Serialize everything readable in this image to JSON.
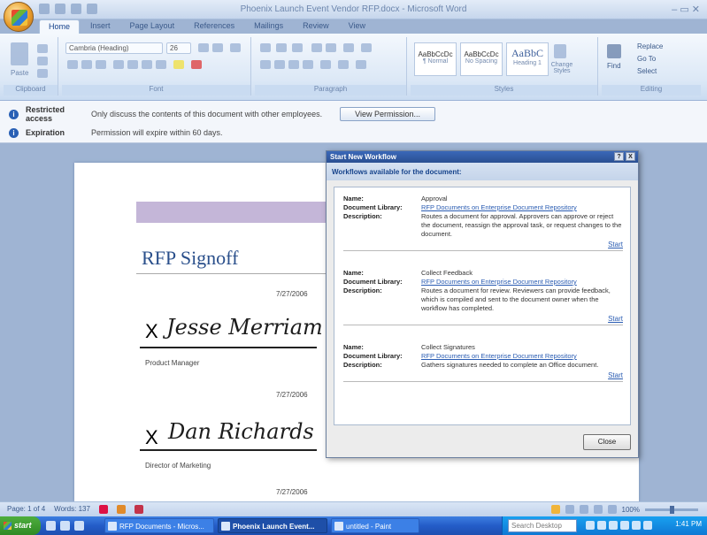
{
  "window": {
    "title": "Phoenix Launch Event Vendor RFP.docx - Microsoft Word",
    "controls": "–  ▭  ✕"
  },
  "ribbon": {
    "tabs": [
      "Home",
      "Insert",
      "Page Layout",
      "References",
      "Mailings",
      "Review",
      "View"
    ],
    "font_name": "Cambria (Heading)",
    "font_size": "26",
    "groups": [
      "Clipboard",
      "Font",
      "Paragraph",
      "Styles",
      "Editing"
    ],
    "paste_label": "Paste",
    "styles": [
      {
        "sample": "AaBbCcDc",
        "name": "¶ Normal"
      },
      {
        "sample": "AaBbCcDc",
        "name": "No Spacing"
      },
      {
        "sample": "AaBbC",
        "name": "Heading 1"
      }
    ],
    "change_styles": "Change Styles",
    "find": "Find",
    "replace": "Replace",
    "goto": "Go To",
    "select": "Select"
  },
  "message_bar": {
    "rows": [
      {
        "label": "Restricted access",
        "text": "Only discuss the contents of this document with other employees.",
        "button": "View Permission..."
      },
      {
        "label": "Expiration",
        "text": "Permission will expire within 60 days."
      }
    ]
  },
  "document": {
    "title": "RFP Signoff",
    "signatures": [
      {
        "date": "7/27/2006",
        "x": "X",
        "name": "Jesse Merriam",
        "role": "Product Manager"
      },
      {
        "date": "7/27/2006",
        "x": "X",
        "name": "Dan Richards",
        "role": "Director of Marketing"
      }
    ],
    "trailing_date": "7/27/2006"
  },
  "dialog": {
    "title": "Start New Workflow",
    "ctrl_help": "?",
    "ctrl_close": "X",
    "header": "Workflows available for the document:",
    "key_name": "Name:",
    "key_library": "Document Library:",
    "key_description": "Description:",
    "workflows": [
      {
        "name": "Approval",
        "library": "RFP Documents on Enterprise Document Repository",
        "description": "Routes a document for approval. Approvers can approve or reject the document, reassign the approval task, or request changes to the document.",
        "start": "Start"
      },
      {
        "name": "Collect Feedback",
        "library": "RFP Documents on Enterprise Document Repository",
        "description": "Routes a document for review. Reviewers can provide feedback, which is compiled and sent to the document owner when the workflow has completed.",
        "start": "Start"
      },
      {
        "name": "Collect Signatures",
        "library": "RFP Documents on Enterprise Document Repository",
        "description": "Gathers signatures needed to complete an Office document.",
        "start": "Start"
      }
    ],
    "close_label": "Close"
  },
  "status_bar": {
    "page": "Page: 1 of 4",
    "words": "Words: 137",
    "zoom": "100%"
  },
  "taskbar": {
    "start": "start",
    "tasks": [
      {
        "label": "RFP Documents - Micros..."
      },
      {
        "label": "Phoenix Launch Event..."
      },
      {
        "label": "untitled - Paint"
      }
    ],
    "search_placeholder": "Search Desktop",
    "clock": "1:41 PM"
  }
}
